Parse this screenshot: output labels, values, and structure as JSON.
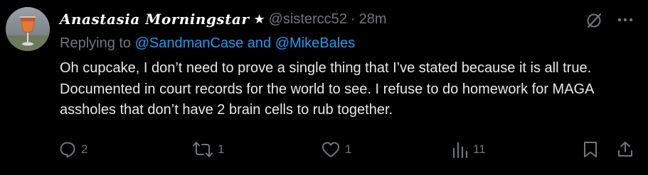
{
  "author": {
    "display_name": "Anastasia Morningstar",
    "name_badge": "★",
    "handle": "@sistercc52",
    "separator": "·",
    "timestamp": "28m"
  },
  "reply_context": {
    "prefix": "Replying to ",
    "mention_1": "@SandmanCase",
    "joiner": " and ",
    "mention_2": "@MikeBales"
  },
  "body": "Oh cupcake, I don’t need to prove a single thing that I’ve stated because it is all true. Documented in court records for the world to see. I refuse to do homework for MAGA assholes that don’t have 2 brain cells to rub together.",
  "actions": {
    "replies": "2",
    "reposts": "1",
    "likes": "1",
    "views": "11"
  },
  "icons": {
    "header_right": [
      "grok-icon",
      "more-icon"
    ],
    "action_bar": [
      "reply-icon",
      "repost-icon",
      "like-icon",
      "views-icon",
      "bookmark-icon",
      "share-icon"
    ]
  },
  "colors": {
    "background": "#000000",
    "text": "#e7e9ea",
    "muted": "#71767b",
    "link": "#1d9bf0"
  }
}
